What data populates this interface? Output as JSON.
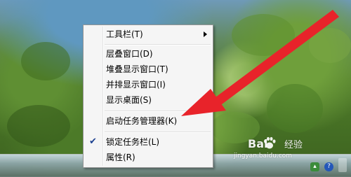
{
  "context_menu": {
    "items": [
      {
        "label": "工具栏(T)",
        "has_submenu": true,
        "checked": false
      },
      {
        "label": "层叠窗口(D)",
        "has_submenu": false,
        "checked": false
      },
      {
        "label": "堆叠显示窗口(T)",
        "has_submenu": false,
        "checked": false
      },
      {
        "label": "并排显示窗口(I)",
        "has_submenu": false,
        "checked": false
      },
      {
        "label": "显示桌面(S)",
        "has_submenu": false,
        "checked": false
      },
      {
        "label": "启动任务管理器(K)",
        "has_submenu": false,
        "checked": false
      },
      {
        "label": "锁定任务栏(L)",
        "has_submenu": false,
        "checked": true
      },
      {
        "label": "属性(R)",
        "has_submenu": false,
        "checked": false
      }
    ]
  },
  "watermark": {
    "brand_left": "Bai",
    "brand_right": "经验",
    "url": "jingyan.baidu.com"
  },
  "annotation": {
    "arrow_color": "#e8232a"
  },
  "icons": {
    "check": "check-icon",
    "submenu": "submenu-arrow-icon",
    "watermark_paw": "baidu-paw-icon",
    "tray": [
      "flag-tray-icon",
      "help-tray-icon"
    ]
  }
}
